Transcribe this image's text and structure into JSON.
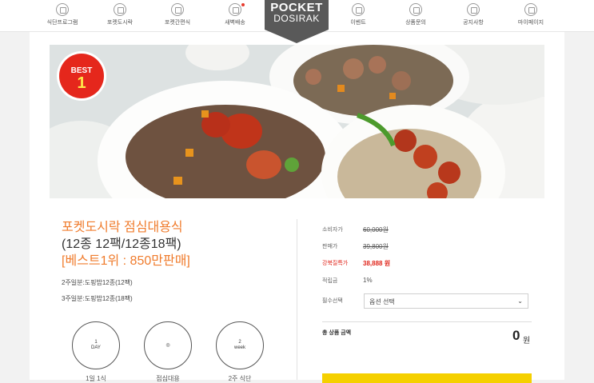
{
  "nav": {
    "items": [
      {
        "label": "식단프로그램",
        "icon": "menu-program-icon"
      },
      {
        "label": "포켓도시락",
        "icon": "lunchbox-icon"
      },
      {
        "label": "포켓간편식",
        "icon": "simple-meal-icon"
      },
      {
        "label": "새벽배송",
        "icon": "delivery-icon",
        "dot": true
      },
      {
        "label": "이벤트",
        "icon": "gift-icon"
      },
      {
        "label": "상품문의",
        "icon": "inquiry-icon"
      },
      {
        "label": "공지사항",
        "icon": "bell-icon"
      },
      {
        "label": "마이페이지",
        "icon": "user-icon"
      }
    ],
    "logo_line1": "POCKET",
    "logo_line2": "DOSIRAK"
  },
  "badge": {
    "line1": "BEST",
    "line2": "1"
  },
  "product": {
    "title1": "포켓도시락 점심대용식",
    "title2": "(12종 12팩/12종18팩)",
    "title3": "[베스트1위 : 850만판매]",
    "options": [
      "2주일분:도핑밥12종(12팩)",
      "3주일분:도핑밥12종(18팩)"
    ],
    "circles": [
      {
        "inner1": "1",
        "inner2": "DAY",
        "label": "1일 1식"
      },
      {
        "inner1": "",
        "inner2": "",
        "label": "점심대용"
      },
      {
        "inner1": "2",
        "inner2": "week",
        "label": "2주 식단"
      }
    ]
  },
  "pricing": {
    "consumer_label": "소비자가",
    "consumer_value": "60,000원",
    "sale_label": "판매가",
    "sale_value": "39,800원",
    "special_label": "강북질특가",
    "special_value": "38,888 원",
    "points_label": "적립금",
    "points_value": "1%",
    "required_label": "필수선택",
    "select_placeholder": "옵션 선택",
    "total_label": "총 상품 금액",
    "total_value": "0",
    "total_unit": "원"
  },
  "colors": {
    "accent": "#f07c2d",
    "special": "#e0251b",
    "logo": "#595959",
    "badge": "#e5271c",
    "buy": "#f5d000"
  }
}
